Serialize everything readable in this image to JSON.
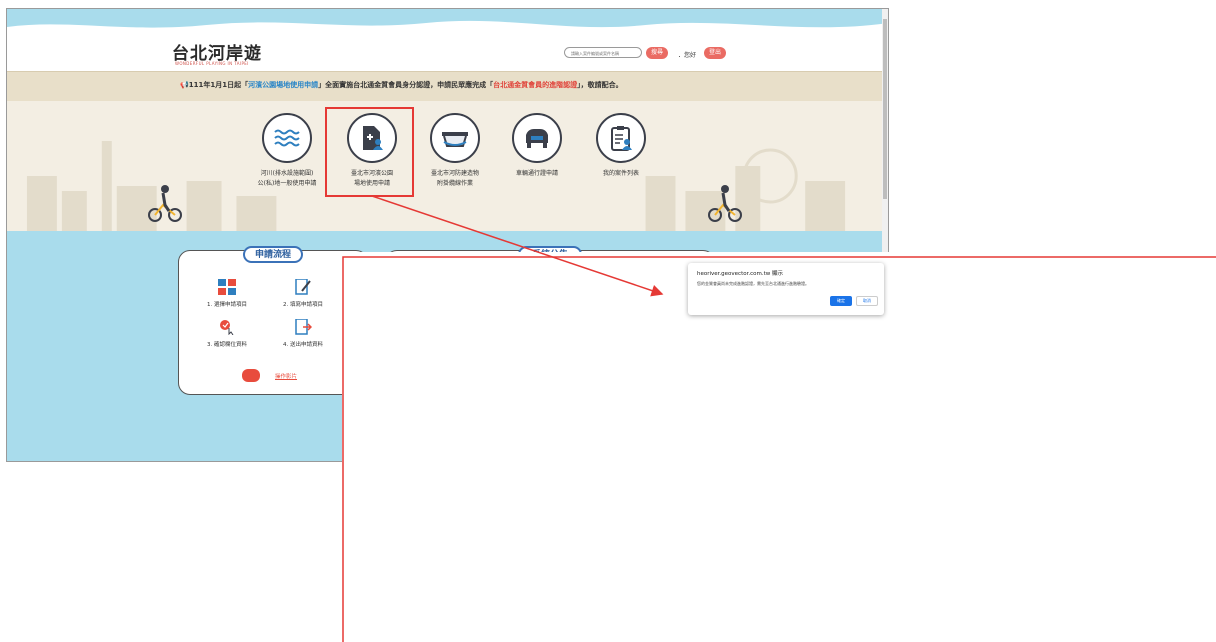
{
  "header": {
    "logo_text": "台北河岸遊",
    "logo_sub": "WONDERFUL PLAYING IN TAIPEI",
    "search_placeholder": "請輸入案件編號或案件名稱",
    "search_button": "搜尋",
    "greeting": "．您好",
    "logout_button": "登出"
  },
  "announcement": {
    "prefix": "📢111年1月1日起「",
    "highlight1": "河濱公園場地使用申請",
    "middle": "」全面實施台北通金質會員身分認證，申請民眾應完成「",
    "highlight2": "台北通金質會員的進階認證",
    "suffix": "」，敬請配合。"
  },
  "services": [
    {
      "label1": "河川(排水設施範圍)",
      "label2": "公(私)地一般使用申請"
    },
    {
      "label1": "臺北市河濱公園",
      "label2": "場地使用申請"
    },
    {
      "label1": "臺北市河防建造物",
      "label2": "附掛纜線作業"
    },
    {
      "label1": "車輛通行證申請",
      "label2": ""
    },
    {
      "label1": "我的案件列表",
      "label2": ""
    }
  ],
  "process": {
    "title": "申請流程",
    "steps": [
      "1. 選擇申請項目",
      "2. 填寫申請項目",
      "3. 確認欄位資料",
      "4. 送出申請資料"
    ],
    "video_link": "操作影片"
  },
  "announcements_panel": {
    "title": "系統公告"
  },
  "dialog": {
    "title": "heoriver.geovector.com.tw 顯示",
    "message": "您的金質會員尚未完成進階認證，需先至台北通進行進階驗證。",
    "ok": "確定",
    "cancel": "取消"
  },
  "colors": {
    "accent_red": "#ea6b63",
    "river_blue": "#a9dcec",
    "annotation_red": "#e53935",
    "button_blue": "#1a73e8"
  }
}
